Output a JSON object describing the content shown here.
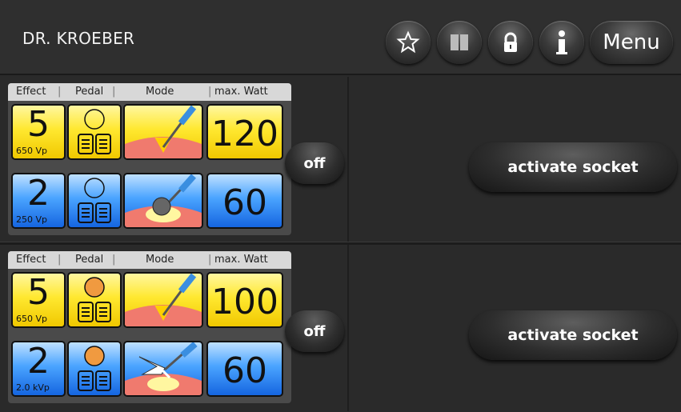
{
  "header": {
    "title": "DR. KROEBER",
    "menu_label": "Menu",
    "icons": [
      "star-icon",
      "book-icon",
      "lock-icon",
      "info-icon"
    ]
  },
  "columns": {
    "effect": "Effect",
    "pedal": "Pedal",
    "mode": "Mode",
    "max_watt": "max. Watt"
  },
  "sockets": [
    {
      "off_label": "off",
      "activate_label": "activate socket",
      "yellow": {
        "effect": "5",
        "voltage": "650 Vp",
        "pedal_indicator": "empty",
        "mode_icon": "cut-electrode-icon",
        "max_watt": "120"
      },
      "blue": {
        "effect": "2",
        "voltage": "250 Vp",
        "pedal_indicator": "empty",
        "mode_icon": "ball-electrode-icon",
        "max_watt": "60"
      }
    },
    {
      "off_label": "off",
      "activate_label": "activate socket",
      "yellow": {
        "effect": "5",
        "voltage": "650 Vp",
        "pedal_indicator": "active",
        "mode_icon": "cut-electrode-icon",
        "max_watt": "100"
      },
      "blue": {
        "effect": "2",
        "voltage": "2.0 kVp",
        "pedal_indicator": "active",
        "mode_icon": "spark-coag-icon",
        "max_watt": "60"
      }
    }
  ],
  "colors": {
    "yellow": "#ffe830",
    "blue": "#3d8ef5",
    "pedal_active": "#f09a40",
    "tissue": "#f07a6e"
  }
}
